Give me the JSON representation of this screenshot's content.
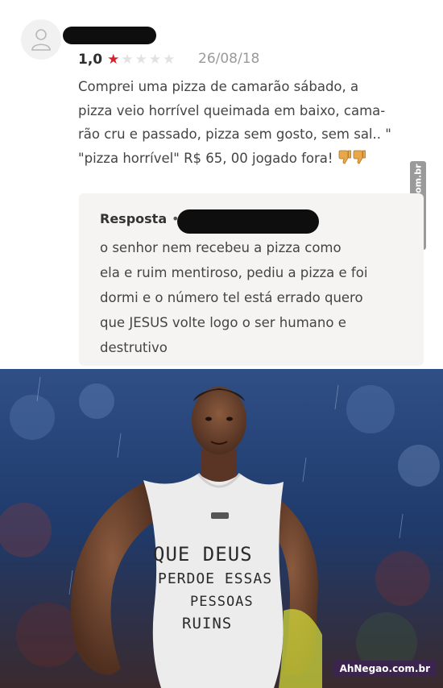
{
  "review": {
    "rating": "1,0",
    "stars_filled": 1,
    "stars_total": 5,
    "date": "26/08/18",
    "text_lines": [
      "Comprei uma pizza de camarão sábado, a",
      "pizza veio horrível queimada em baixo, cama-",
      "rão cru e passado, pizza sem gosto, sem sal.. \"",
      "\"pizza horrível\"  R$ 65, 00 jogado fora!"
    ],
    "icons": [
      "user-avatar-icon",
      "star-icon",
      "thumbs-down-icon"
    ]
  },
  "reply": {
    "label": "Resposta",
    "dot": "•",
    "text_lines": [
      "o senhor nem recebeu a pizza como",
      "ela e ruim mentiroso, pediu a pizza e foi",
      "dormi e o número tel está errado quero",
      "que JESUS volte logo o ser humano e",
      "destrutivo"
    ]
  },
  "photo": {
    "shirt_lines": [
      "QUE DEUS",
      "PERDOE ESSAS",
      "PESSOAS",
      "RUINS"
    ]
  },
  "watermarks": {
    "side": "AhNegao.com.br",
    "bottom": "AhNegao.com.br"
  },
  "colors": {
    "star_on": "#d4232b",
    "star_off": "#e2e2e2",
    "reply_bg": "#f6f4f2",
    "redaction": "#0e0e0e"
  }
}
